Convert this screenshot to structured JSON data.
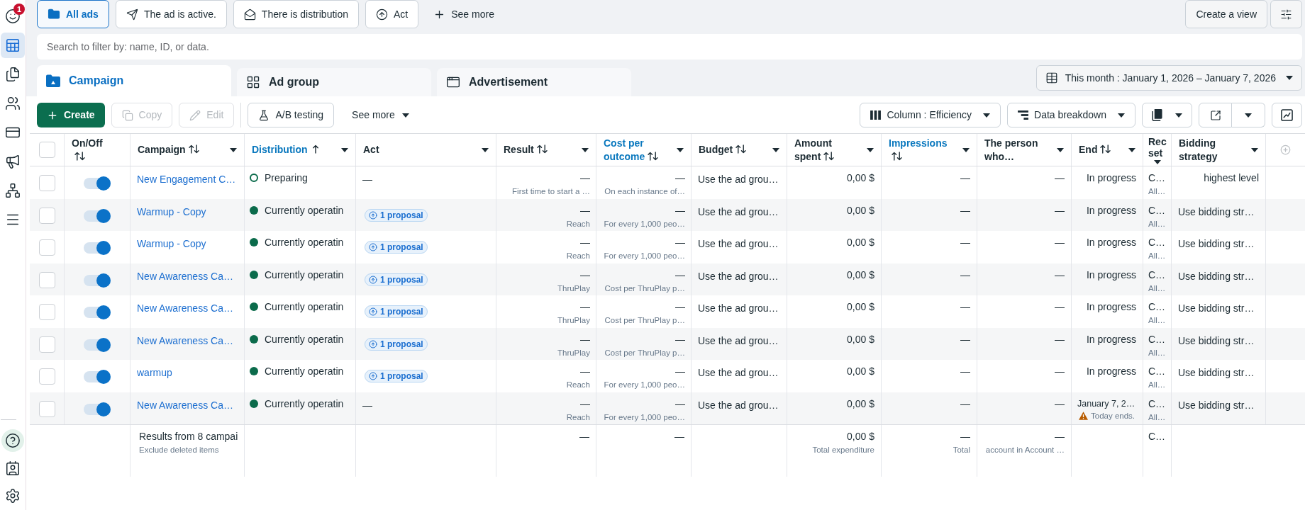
{
  "sidebar": {
    "items": [
      {
        "selected": false,
        "badge": "1"
      },
      {
        "selected": true
      },
      {
        "selected": false
      },
      {
        "selected": false
      },
      {
        "selected": false
      },
      {
        "selected": false
      },
      {
        "selected": false
      },
      {
        "selected": false
      }
    ],
    "bottom_items": [
      {
        "selected": false
      },
      {
        "selected": false
      },
      {
        "selected": false
      }
    ]
  },
  "filters": [
    {
      "label": "All ads",
      "selected": true
    },
    {
      "label": "The ad is active.",
      "selected": false
    },
    {
      "label": "There is distribution",
      "selected": false
    },
    {
      "label": "Act",
      "selected": false
    }
  ],
  "see_more_filters": "See more",
  "create_view": "Create a view",
  "search": {
    "placeholder": "Search to filter by: name, ID, or data."
  },
  "tabs": [
    {
      "label": "Campaign",
      "selected": true
    },
    {
      "label": "Ad group",
      "selected": false
    },
    {
      "label": "Advertisement",
      "selected": false
    }
  ],
  "date_range": "This month : January 1, 2026 – January 7, 2026",
  "toolbar": {
    "actions": [
      {
        "label": "Create",
        "kind": "primary",
        "disabled": false
      },
      {
        "label": "Copy",
        "kind": "secondary",
        "disabled": true
      },
      {
        "label": "Edit",
        "kind": "secondary",
        "disabled": true
      },
      {
        "label": "A/B testing",
        "kind": "secondary",
        "disabled": false
      }
    ],
    "see_more": "See more",
    "columns_preset": "Column : Efficiency",
    "breakdown": "Data breakdown"
  },
  "table": {
    "select_all": {
      "checked": false
    },
    "columns": [
      {
        "label": "On/Off",
        "sortable": true,
        "sorted": false,
        "menu": false,
        "highlighted": false
      },
      {
        "label": "Campaign",
        "sortable": true,
        "sorted": false,
        "menu": true,
        "highlighted": false
      },
      {
        "label": "Distribution",
        "sortable": true,
        "sorted": true,
        "menu": true,
        "highlighted": true
      },
      {
        "label": "Act",
        "sortable": false,
        "menu": true,
        "highlighted": false
      },
      {
        "label": "Result",
        "sortable": true,
        "sorted": false,
        "menu": true,
        "highlighted": false
      },
      {
        "label": "Cost per outcome",
        "sortable": true,
        "sorted": false,
        "menu": true,
        "highlighted": true
      },
      {
        "label": "Budget",
        "sortable": true,
        "sorted": false,
        "menu": true,
        "highlighted": false
      },
      {
        "label": "Amount spent",
        "sortable": true,
        "sorted": false,
        "menu": true,
        "highlighted": false
      },
      {
        "label": "Impressions",
        "sortable": true,
        "sorted": false,
        "menu": true,
        "highlighted": true
      },
      {
        "label": "The person who…",
        "sortable": false,
        "menu": true,
        "highlighted": false
      },
      {
        "label": "End",
        "sortable": true,
        "sorted": false,
        "menu": true,
        "highlighted": false
      },
      {
        "label": "Rec set",
        "sortable": false,
        "menu": true,
        "highlighted": false
      },
      {
        "label": "Bidding strategy",
        "sortable": false,
        "menu": true,
        "highlighted": false
      }
    ],
    "rows": [
      {
        "checked": false,
        "on": true,
        "campaign": "New Engagement C…",
        "distribution": {
          "active": false,
          "label": "Preparing"
        },
        "act": {
          "kind": "dash",
          "text": "—"
        },
        "result": {
          "value": "—",
          "note": "First time to start a …"
        },
        "cost_per_outcome": {
          "value": "—",
          "note": "On each instance of…"
        },
        "budget": "Use the ad grou…",
        "amount_spent": "0,00 $",
        "impressions": "—",
        "the_person_who": "—",
        "end": {
          "value": "In progress"
        },
        "column_12": {
          "value": "C…",
          "note": "All…"
        },
        "bidding_strategy": {
          "kind": "own",
          "text": "highest level"
        }
      },
      {
        "checked": false,
        "on": true,
        "campaign": "Warmup - Copy",
        "distribution": {
          "active": true,
          "label": "Currently operatin"
        },
        "act": {
          "kind": "proposal",
          "text": "1 proposal"
        },
        "result": {
          "value": "—",
          "note": "Reach"
        },
        "cost_per_outcome": {
          "value": "—",
          "note": "For every 1,000 peo…"
        },
        "budget": "Use the ad grou…",
        "amount_spent": "0,00 $",
        "impressions": "—",
        "the_person_who": "—",
        "end": {
          "value": "In progress"
        },
        "column_12": {
          "value": "C…",
          "note": "All…"
        },
        "bidding_strategy": {
          "kind": "inherited",
          "text": "Use bidding str…"
        }
      },
      {
        "checked": false,
        "on": true,
        "campaign": "Warmup - Copy",
        "distribution": {
          "active": true,
          "label": "Currently operatin"
        },
        "act": {
          "kind": "proposal",
          "text": "1 proposal"
        },
        "result": {
          "value": "—",
          "note": "Reach"
        },
        "cost_per_outcome": {
          "value": "—",
          "note": "For every 1,000 peo…"
        },
        "budget": "Use the ad grou…",
        "amount_spent": "0,00 $",
        "impressions": "—",
        "the_person_who": "—",
        "end": {
          "value": "In progress"
        },
        "column_12": {
          "value": "C…",
          "note": "All…"
        },
        "bidding_strategy": {
          "kind": "inherited",
          "text": "Use bidding str…"
        }
      },
      {
        "checked": false,
        "on": true,
        "campaign": "New Awareness Ca…",
        "distribution": {
          "active": true,
          "label": "Currently operatin"
        },
        "act": {
          "kind": "proposal",
          "text": "1 proposal"
        },
        "result": {
          "value": "—",
          "note": "ThruPlay"
        },
        "cost_per_outcome": {
          "value": "—",
          "note": "Cost per ThruPlay p…"
        },
        "budget": "Use the ad grou…",
        "amount_spent": "0,00 $",
        "impressions": "—",
        "the_person_who": "—",
        "end": {
          "value": "In progress"
        },
        "column_12": {
          "value": "C…",
          "note": "All…"
        },
        "bidding_strategy": {
          "kind": "inherited",
          "text": "Use bidding str…"
        }
      },
      {
        "checked": false,
        "on": true,
        "campaign": "New Awareness Ca…",
        "distribution": {
          "active": true,
          "label": "Currently operatin"
        },
        "act": {
          "kind": "proposal",
          "text": "1 proposal"
        },
        "result": {
          "value": "—",
          "note": "ThruPlay"
        },
        "cost_per_outcome": {
          "value": "—",
          "note": "Cost per ThruPlay p…"
        },
        "budget": "Use the ad grou…",
        "amount_spent": "0,00 $",
        "impressions": "—",
        "the_person_who": "—",
        "end": {
          "value": "In progress"
        },
        "column_12": {
          "value": "C…",
          "note": "All…"
        },
        "bidding_strategy": {
          "kind": "inherited",
          "text": "Use bidding str…"
        }
      },
      {
        "checked": false,
        "on": true,
        "campaign": "New Awareness Ca…",
        "distribution": {
          "active": true,
          "label": "Currently operatin"
        },
        "act": {
          "kind": "proposal",
          "text": "1 proposal"
        },
        "result": {
          "value": "—",
          "note": "ThruPlay"
        },
        "cost_per_outcome": {
          "value": "—",
          "note": "Cost per ThruPlay p…"
        },
        "budget": "Use the ad grou…",
        "amount_spent": "0,00 $",
        "impressions": "—",
        "the_person_who": "—",
        "end": {
          "value": "In progress"
        },
        "column_12": {
          "value": "C…",
          "note": "All…"
        },
        "bidding_strategy": {
          "kind": "inherited",
          "text": "Use bidding str…"
        }
      },
      {
        "checked": false,
        "on": true,
        "campaign": "warmup",
        "distribution": {
          "active": true,
          "label": "Currently operatin"
        },
        "act": {
          "kind": "proposal",
          "text": "1 proposal"
        },
        "result": {
          "value": "—",
          "note": "Reach"
        },
        "cost_per_outcome": {
          "value": "—",
          "note": "For every 1,000 peo…"
        },
        "budget": "Use the ad grou…",
        "amount_spent": "0,00 $",
        "impressions": "—",
        "the_person_who": "—",
        "end": {
          "value": "In progress"
        },
        "column_12": {
          "value": "C…",
          "note": "All…"
        },
        "bidding_strategy": {
          "kind": "inherited",
          "text": "Use bidding str…"
        }
      },
      {
        "checked": false,
        "on": true,
        "campaign": "New Awareness Ca…",
        "distribution": {
          "active": true,
          "label": "Currently operatin"
        },
        "act": {
          "kind": "dash",
          "text": "—"
        },
        "result": {
          "value": "—",
          "note": "Reach"
        },
        "cost_per_outcome": {
          "value": "—",
          "note": "For every 1,000 peo…"
        },
        "budget": "Use the ad grou…",
        "amount_spent": "0,00 $",
        "impressions": "—",
        "the_person_who": "—",
        "end": {
          "value": "January 7, 2…",
          "warning": "Today ends."
        },
        "column_12": {
          "value": "C…",
          "note": "All…"
        },
        "bidding_strategy": {
          "kind": "inherited",
          "text": "Use bidding str…"
        }
      }
    ],
    "totals": {
      "campaign": {
        "value": "Results from 8 campai",
        "note": "Exclude deleted items"
      },
      "result": {
        "value": "—"
      },
      "cost_per_outcome": {
        "value": "—"
      },
      "amount_spent": {
        "value": "0,00 $",
        "note": "Total expenditure"
      },
      "impressions": {
        "value": "—",
        "note": "Total"
      },
      "the_person_who": {
        "value": "—",
        "note": "account in Account …"
      },
      "column_12": {
        "value": "C…"
      }
    }
  }
}
